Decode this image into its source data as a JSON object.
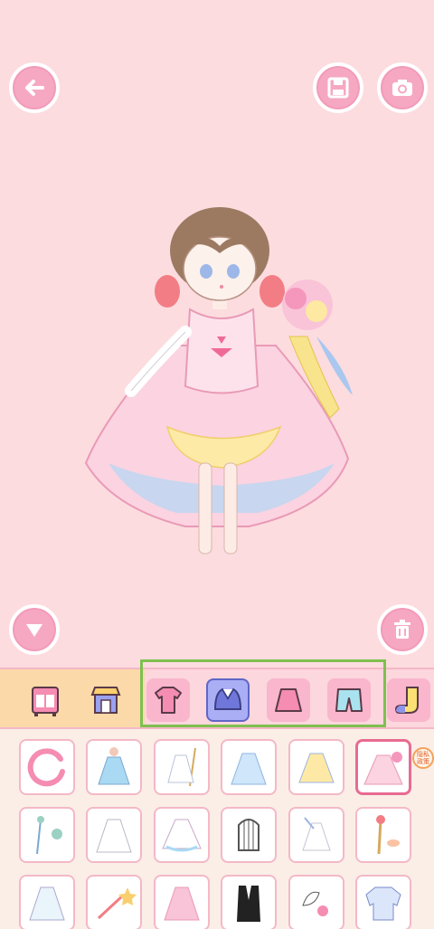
{
  "toolbar": {
    "back_icon": "arrow-left-icon",
    "save_icon": "floppy-disk-icon",
    "camera_icon": "camera-icon",
    "collapse_icon": "triangle-down-icon",
    "delete_icon": "trash-icon"
  },
  "categories": [
    {
      "name": "wardrobe",
      "icon": "wardrobe-icon"
    },
    {
      "name": "shop",
      "icon": "shop-icon"
    },
    {
      "name": "tops",
      "icon": "shirt-icon"
    },
    {
      "name": "outerwear",
      "icon": "jacket-icon",
      "selected": true
    },
    {
      "name": "skirts",
      "icon": "skirt-icon"
    },
    {
      "name": "pants",
      "icon": "shorts-icon"
    },
    {
      "name": "socks",
      "icon": "sock-icon"
    }
  ],
  "items_grid": {
    "selected_index": 5,
    "items": [
      "reset-icon",
      "blue-dress-icon",
      "white-dress-icon",
      "ice-dress-icon",
      "yellow-dress-icon",
      "pink-gown-icon",
      "wand-icon",
      "wedding-dress-icon",
      "tulle-gown-icon",
      "cage-icon",
      "fairy-dress-icon",
      "scepter-icon",
      "lace-dress-icon",
      "star-wand-icon",
      "candy-dress-icon",
      "tuxedo-icon",
      "accessory-icon",
      "blouse-icon"
    ]
  },
  "privacy_badge": {
    "line1": "隐私",
    "line2": "政策"
  },
  "colors": {
    "background": "#fcdcdf",
    "button_pink": "#f6a8c3",
    "highlight_green": "#7ec04f",
    "selected_blue": "#a9aef5"
  }
}
